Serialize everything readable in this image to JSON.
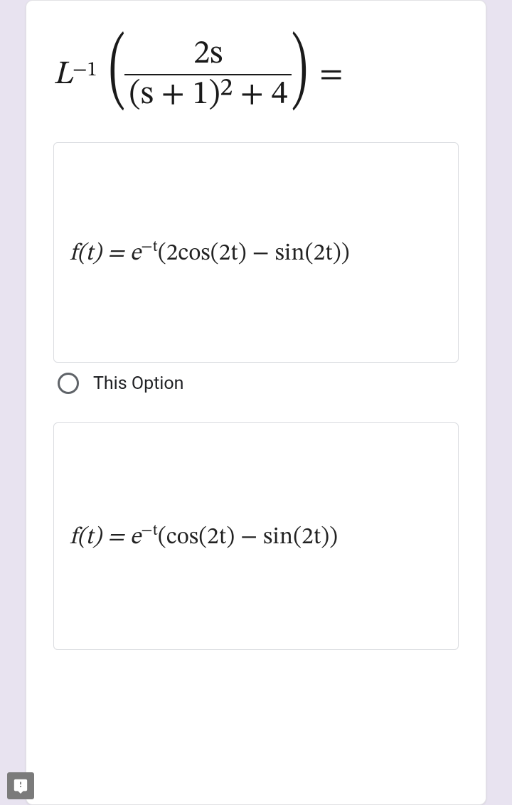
{
  "question": {
    "operator": "L",
    "exponent": "−1",
    "numerator": "2s",
    "denominator": "(s + 1)² + 4",
    "rhs": "="
  },
  "options": [
    {
      "formula_lhs": "f(t) = e",
      "formula_exp": "−t",
      "formula_rhs": "(2cos(2t) − sin(2t))",
      "radio_label": "This Option"
    },
    {
      "formula_lhs": "f(t) = e",
      "formula_exp": "−t",
      "formula_rhs": "(cos(2t) − sin(2t))"
    }
  ],
  "report_icon": "report-problem"
}
